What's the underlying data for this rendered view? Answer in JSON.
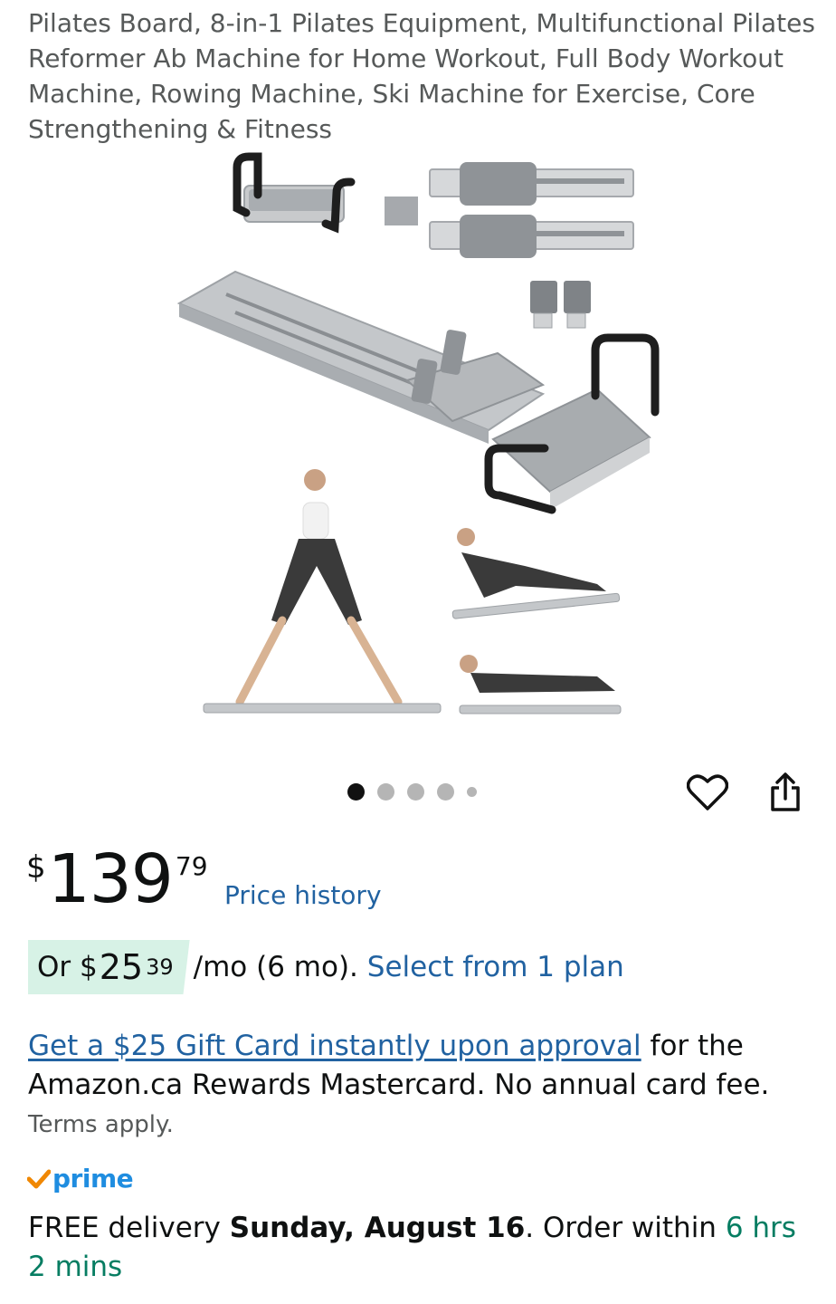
{
  "product": {
    "title": "Pilates Board, 8-in-1 Pilates Equipment, Multifunctional Pilates Reformer Ab Machine for Home Workout, Full Body Workout Machine, Rowing Machine, Ski Machine for Exercise, Core Strengthening & Fitness"
  },
  "gallery": {
    "image_count": 5,
    "active_index": 0,
    "favorite_icon": "heart-outline-icon",
    "share_icon": "share-icon"
  },
  "price": {
    "symbol": "$",
    "whole": "139",
    "fraction": "79",
    "history_link": "Price history"
  },
  "installment": {
    "prefix": "Or",
    "symbol": "$",
    "whole": "25",
    "fraction": "39",
    "term": "/mo (6 mo).",
    "plan_link": "Select from 1 plan"
  },
  "promo": {
    "link_text": "Get a $25 Gift Card instantly upon approval",
    "rest_text": " for the Amazon.ca Rewards Mastercard. No annual card fee.",
    "terms": "Terms apply."
  },
  "prime": {
    "label": "prime",
    "check_color": "#f08804",
    "word_color": "#1f8de0"
  },
  "delivery": {
    "prefix": "FREE delivery ",
    "date": "Sunday, August 16",
    "middle": ". Order within ",
    "countdown": "6 hrs 2 mins"
  },
  "colors": {
    "link": "#2162a1",
    "installment_bg": "#d7f2e6",
    "countdown": "#067d62"
  }
}
